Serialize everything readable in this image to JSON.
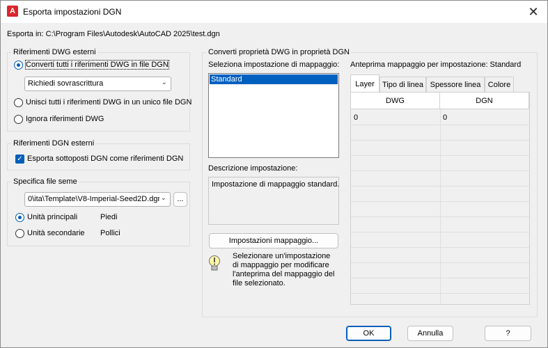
{
  "window": {
    "title": "Esporta impostazioni DGN",
    "app_icon_letter": "A",
    "close_glyph": "✕"
  },
  "export_path": "Esporta in: C:\\Program Files\\Autodesk\\AutoCAD 2025\\test.dgn",
  "dwg_refs": {
    "legend": "Riferimenti DWG esterni",
    "option_convert": "Converti tutti i riferimenti DWG in file DGN",
    "dropdown_value": "Richiedi sovrascrittura",
    "option_merge": "Unisci tutti i riferimenti DWG in un unico file DGN",
    "option_ignore": "Ignora riferimenti DWG",
    "selected": "option_convert"
  },
  "dgn_refs": {
    "legend": "Riferimenti DGN esterni",
    "checkbox_label": "Esporta sottoposti DGN come riferimenti DGN",
    "checked": true
  },
  "seed": {
    "legend": "Specifica file seme",
    "path_value": "0\\ita\\Template\\V8-Imperial-Seed2D.dgn",
    "browse_label": "...",
    "main_units_label": "Unità principali",
    "main_units_value": "Piedi",
    "sub_units_label": "Unità secondarie",
    "sub_units_value": "Pollici",
    "selected": "main_units"
  },
  "convert": {
    "legend": "Converti proprietà DWG in proprietà DGN",
    "select_label": "Seleziona impostazione di mappaggio:",
    "mapping_list": [
      "Standard"
    ],
    "selected_mapping": "Standard",
    "desc_label": "Descrizione impostazione:",
    "desc_text": "Impostazione di mappaggio standard.",
    "mapping_button": "Impostazioni mappaggio...",
    "tip_text": "Selezionare un'impostazione di mappaggio per modificare l'anteprima del mappaggio del file selezionato."
  },
  "preview": {
    "title": "Anteprima mappaggio per impostazione: Standard",
    "tabs": [
      "Layer",
      "Tipo di linea",
      "Spessore linea",
      "Colore"
    ],
    "active_tab": "Layer",
    "columns": [
      "DWG",
      "DGN"
    ],
    "rows": [
      [
        "0",
        "0"
      ]
    ]
  },
  "buttons": {
    "ok": "OK",
    "cancel": "Annulla",
    "help": "?"
  },
  "colors": {
    "accent": "#005fb8",
    "selection": "#0060c0",
    "app_icon": "#d8262c"
  }
}
